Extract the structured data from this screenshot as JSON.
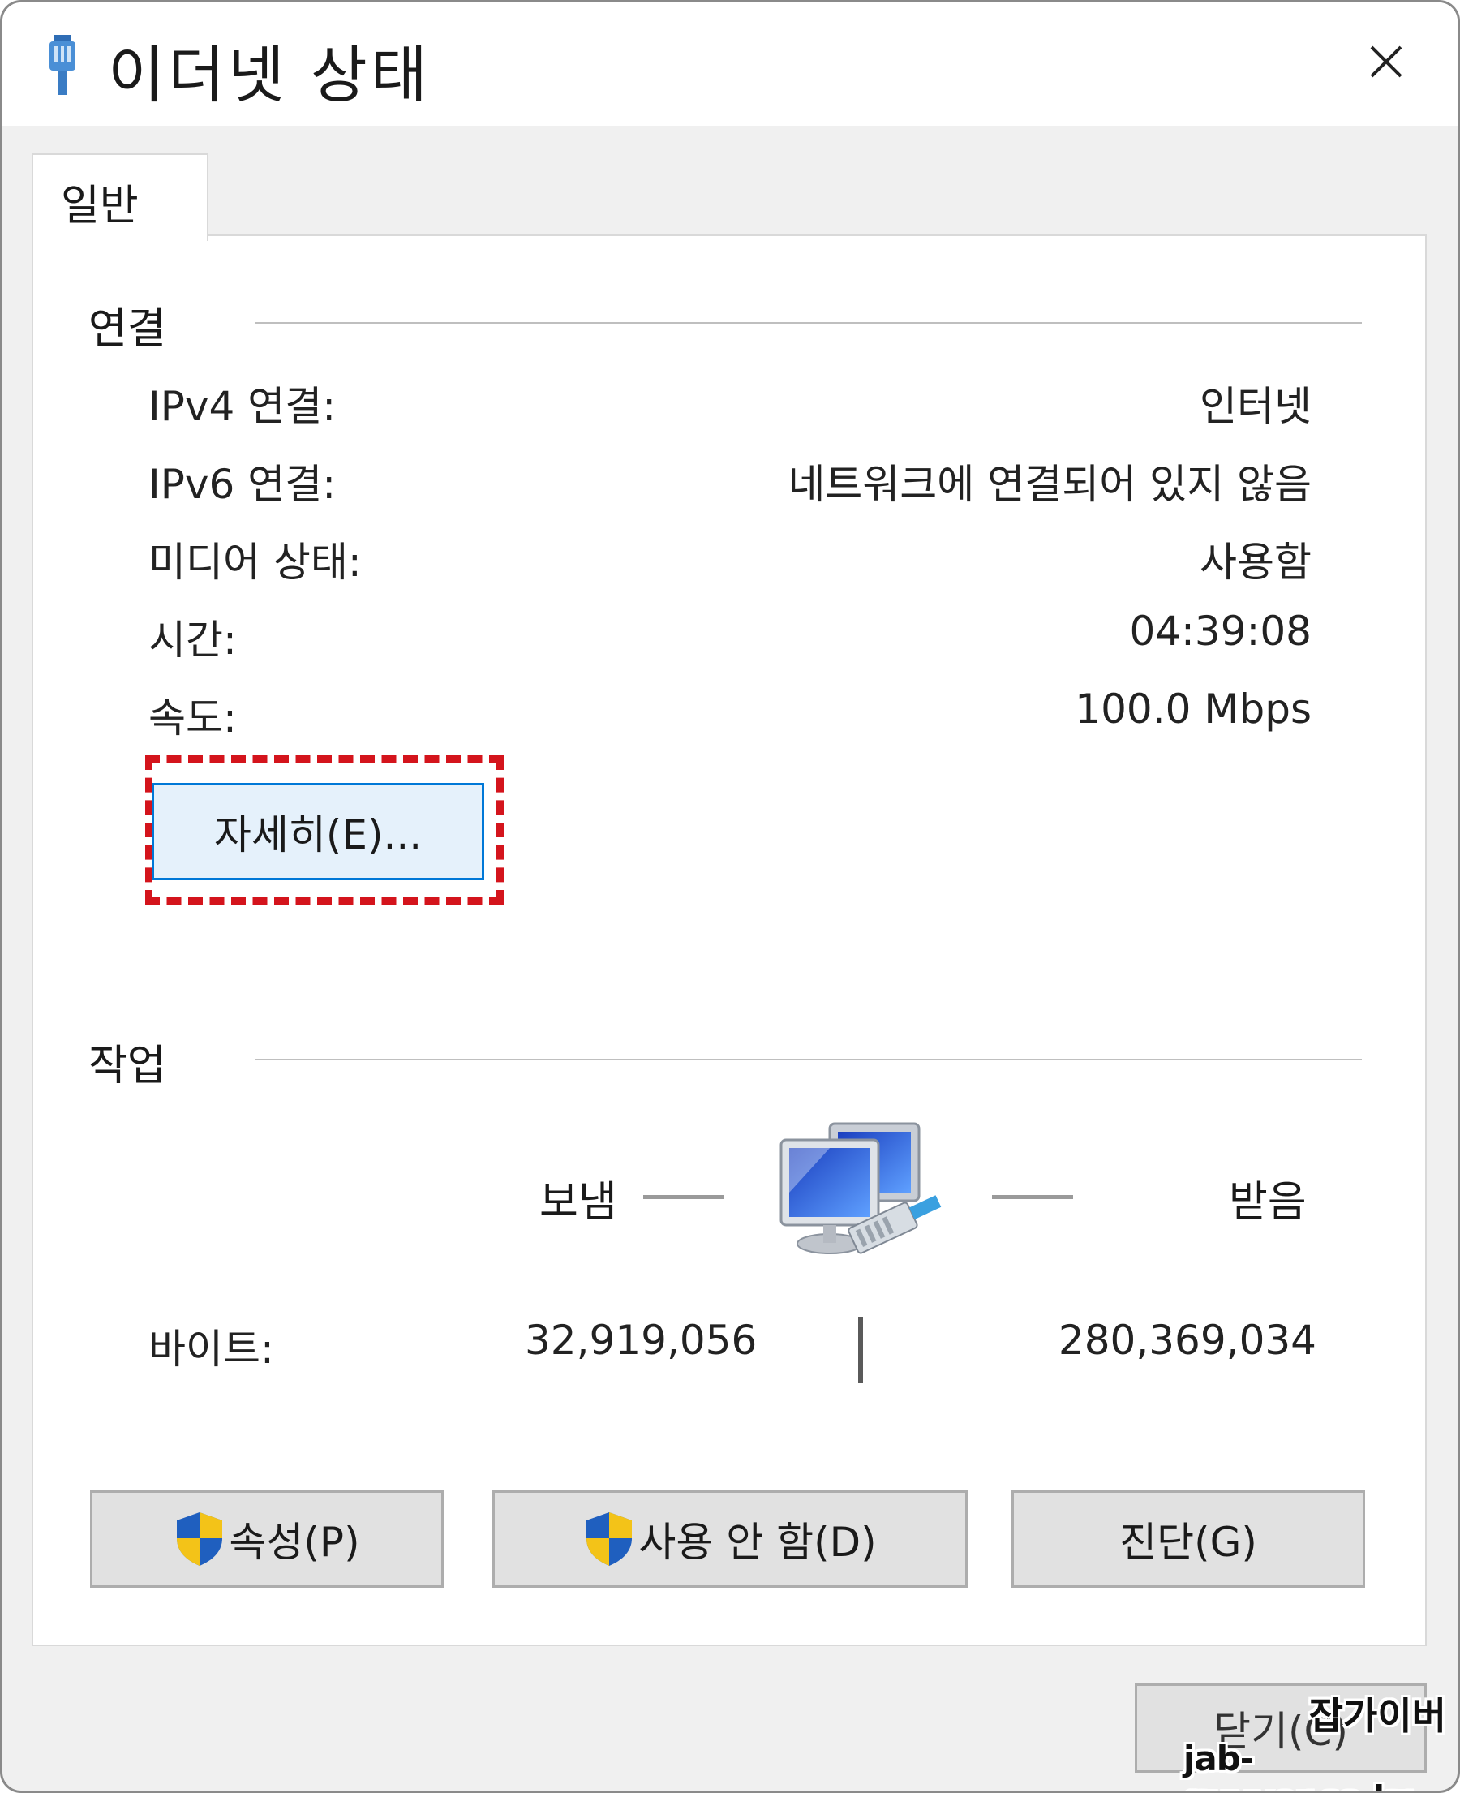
{
  "window": {
    "title": "이더넷 상태",
    "title_icon": "ethernet-cable-icon",
    "close_icon": "close-x-icon"
  },
  "tabs": [
    {
      "label": "일반",
      "selected": true
    }
  ],
  "connection": {
    "heading": "연결",
    "rows": [
      {
        "label": "IPv4 연결:",
        "value": "인터넷"
      },
      {
        "label": "IPv6 연결:",
        "value": "네트워크에 연결되어 있지 않음"
      },
      {
        "label": "미디어 상태:",
        "value": "사용함"
      },
      {
        "label": "시간:",
        "value": "04:39:08"
      },
      {
        "label": "속도:",
        "value": "100.0 Mbps"
      }
    ],
    "details_button": "자세히(E)..."
  },
  "activity": {
    "heading": "작업",
    "sent_label": "보냄",
    "received_label": "받음",
    "network_icon": "network-computers-icon",
    "bytes_label": "바이트:",
    "bytes_sent": "32,919,056",
    "bytes_received": "280,369,034"
  },
  "buttons": {
    "properties": "속성(P)",
    "disable": "사용 안 함(D)",
    "diagnose": "진단(G)",
    "close": "닫기(C)",
    "shield_icon": "uac-shield-icon"
  },
  "watermark": {
    "line1": "잡가이버",
    "line2": "jab-guyver.co.kr"
  },
  "colors": {
    "highlight_border": "#d4141c",
    "focus_border": "#0078d7",
    "focus_fill": "#e5f1fb",
    "button_fill": "#e1e1e1"
  }
}
